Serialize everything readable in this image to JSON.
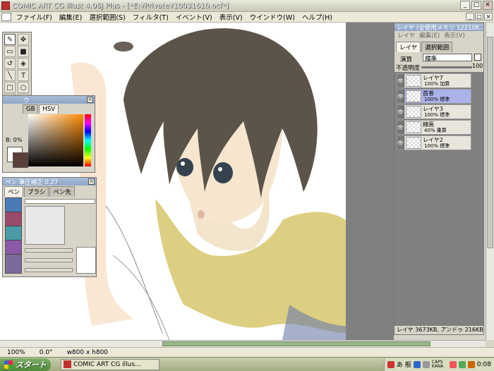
{
  "window": {
    "title": "COMIC ART CG illust 4.06J Plus - [*E:¥Private¥10031610.ocf*]",
    "minimize": "_",
    "maximize": "□",
    "close": "×"
  },
  "menu": {
    "items": [
      "ファイル(F)",
      "編集(E)",
      "選択範囲(S)",
      "フィルタ(T)",
      "イベント(V)",
      "表示(V)",
      "ウインドウ(W)",
      "ヘルプ(H)"
    ]
  },
  "color_panel": {
    "title": "ウ",
    "tabs": [
      "GB",
      "HSV"
    ],
    "label": "B: 0%"
  },
  "pen_panel": {
    "title": "ペン  筆圧補正 0.27",
    "tabs": [
      "ペン",
      "ブラシ",
      "ペン先"
    ]
  },
  "layer_panel": {
    "title": "レイヤ (全使用メモリ 12210K…",
    "menu": [
      "レイヤ",
      "編集(E)",
      "表示(V)"
    ],
    "tabs": [
      "レイヤ",
      "選択範囲"
    ],
    "blend_label": "演算",
    "blend_value": "標準",
    "opacity_label": "不透明度",
    "opacity_value": "100",
    "layers": [
      {
        "name": "レイヤ7",
        "info": "100% 加算"
      },
      {
        "name": "首巻",
        "info": "100% 標準"
      },
      {
        "name": "レイヤ3",
        "info": "100% 標準"
      },
      {
        "name": "線画",
        "info": "40% 乗算"
      },
      {
        "name": "レイヤ2",
        "info": "100% 標準"
      }
    ],
    "footer": "レイヤ 3673KB, アンドゥ 216KB"
  },
  "status": {
    "zoom": "100%",
    "angle": "0.0°",
    "size": "w800 x h800"
  },
  "taskbar": {
    "start": "スタート",
    "task": "COMIC ART CG illus...",
    "ime": "あ 般",
    "caps": "CAPS KANA",
    "clock": "0:08"
  },
  "colors": {
    "hair": "#5c5448",
    "scarf": "#dccf82",
    "skin": "#f6e4cc",
    "panel_header": "#8ea6c8",
    "selected_layer": "#aab2e8"
  }
}
